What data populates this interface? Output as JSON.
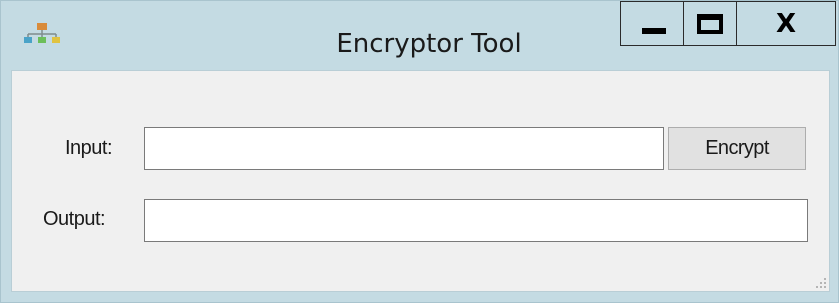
{
  "window": {
    "title": "Encryptor Tool",
    "icon": "network-hierarchy-icon",
    "caption_buttons": {
      "minimize": "minimize-icon",
      "maximize": "maximize-icon",
      "close_label": "X"
    }
  },
  "form": {
    "input_label": "Input:",
    "input_value": "",
    "output_label": "Output:",
    "output_value": "",
    "encrypt_label": "Encrypt"
  },
  "colors": {
    "frame": "#c4dbe3",
    "client_background": "#f0f0f0",
    "button_background": "#e1e1e1"
  }
}
